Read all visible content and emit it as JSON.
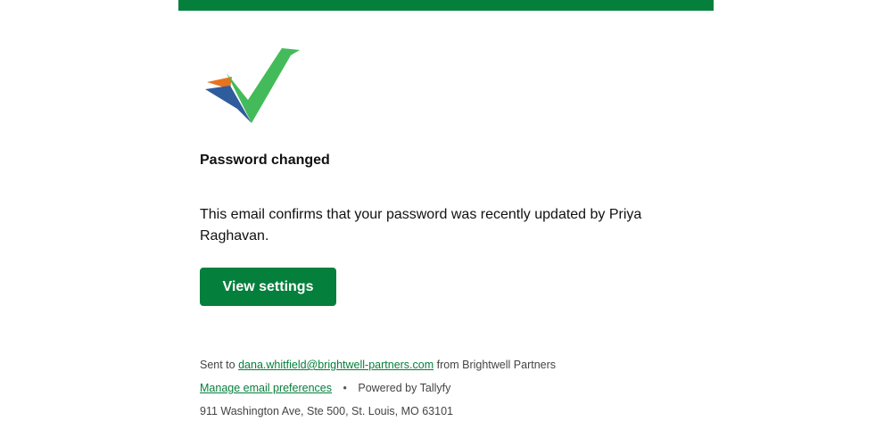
{
  "colors": {
    "brand_green": "#057f3c",
    "logo_green": "#44bb5a",
    "logo_blue": "#2f5c9c",
    "logo_orange": "#e8731e"
  },
  "logo": {
    "icon": "tallyfy-checkmark-logo-icon"
  },
  "email": {
    "heading": "Password changed",
    "body": "This email confirms that your password was recently updated by Priya Raghavan.",
    "button_label": "View settings"
  },
  "footer": {
    "sent_to_prefix": "Sent to",
    "recipient_email": "dana.whitfield@brightwell-partners.com",
    "from_text": "from Brightwell Partners",
    "manage_link": "Manage email preferences",
    "separator": "•",
    "powered_by": "Powered by Tallyfy",
    "address": "911 Washington Ave, Ste 500, St. Louis, MO 63101"
  }
}
